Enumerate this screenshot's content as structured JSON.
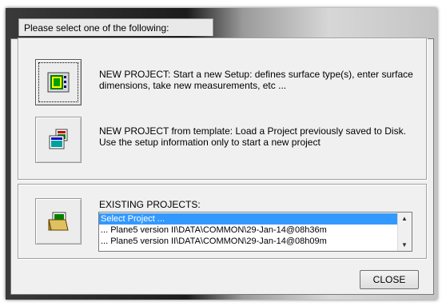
{
  "dialog": {
    "title": "Please select one of the following:"
  },
  "options": {
    "new_project": {
      "text": "NEW PROJECT: Start a new Setup: defines surface type(s), enter surface dimensions,  take new measurements, etc ...",
      "icon": "new-setup-icon"
    },
    "new_from_template": {
      "text": "NEW PROJECT from template: Load a  Project previously saved to  Disk.  Use the setup information only to start a new project",
      "icon": "template-icon"
    },
    "existing": {
      "label": "EXISTING PROJECTS:",
      "icon": "open-folder-icon",
      "items": [
        "Select Project ...",
        "... Plane5 version II\\DATA\\COMMON\\29-Jan-14@08h36m",
        "... Plane5 version II\\DATA\\COMMON\\29-Jan-14@08h09m"
      ],
      "selected_index": 0
    }
  },
  "buttons": {
    "close": "CLOSE"
  },
  "colors": {
    "selection": "#3399ff",
    "dialog_bg": "#f0f0f0"
  }
}
